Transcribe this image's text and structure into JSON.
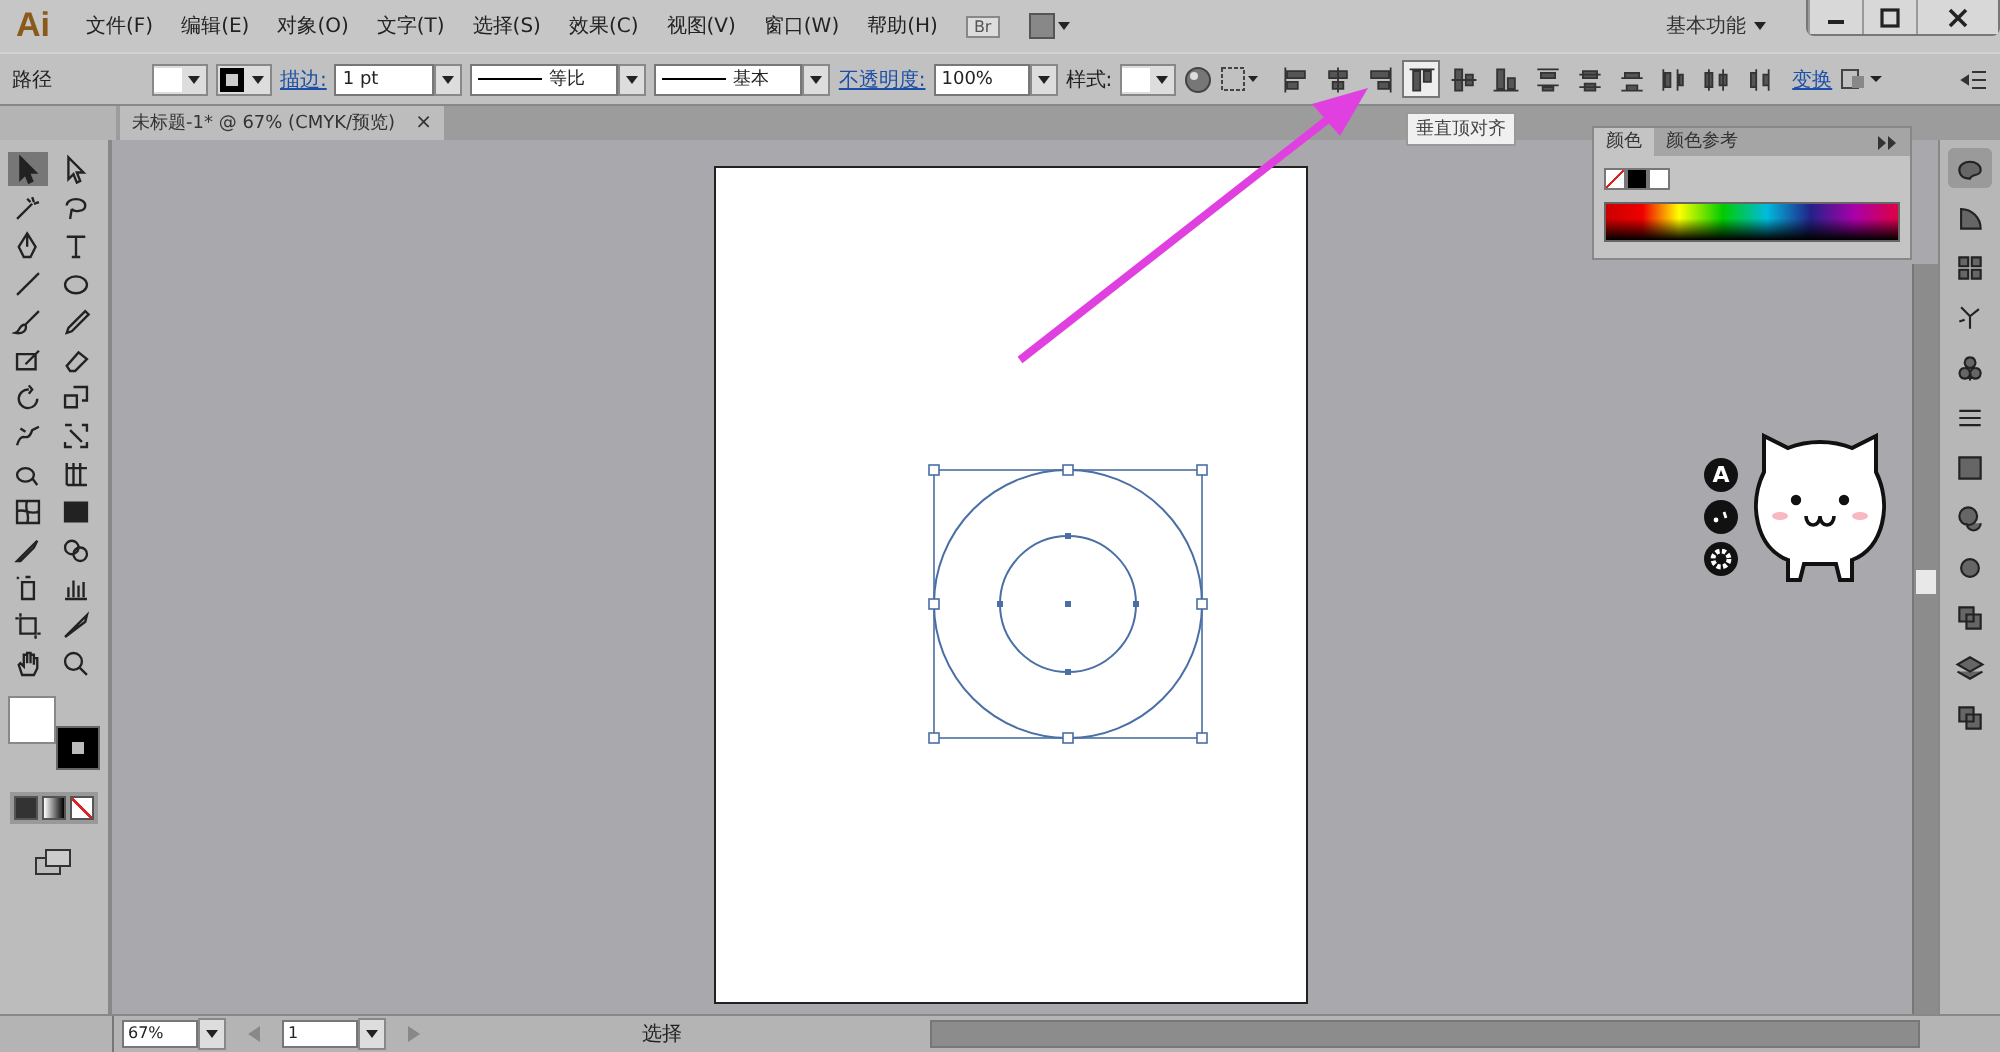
{
  "menu_bar": {
    "logo": "Ai",
    "items": [
      "文件(F)",
      "编辑(E)",
      "对象(O)",
      "文字(T)",
      "选择(S)",
      "效果(C)",
      "视图(V)",
      "窗口(W)",
      "帮助(H)"
    ],
    "bridge": "Br",
    "workspace": "基本功能"
  },
  "control_bar": {
    "selection_label": "路径",
    "stroke_label": "描边:",
    "stroke_weight": "1 pt",
    "profile_1": "等比",
    "profile_2": "基本",
    "opacity_label": "不透明度:",
    "opacity": "100%",
    "style_label": "样式:",
    "transform_label": "变换",
    "align_buttons": [
      {
        "selected": false
      },
      {
        "selected": false
      },
      {
        "selected": false
      },
      {
        "selected": true
      },
      {
        "selected": false
      },
      {
        "selected": false
      },
      {
        "selected": false
      },
      {
        "selected": false
      },
      {
        "selected": false
      },
      {
        "selected": false
      },
      {
        "selected": false
      },
      {
        "selected": false
      }
    ]
  },
  "tooltip": "垂直顶对齐",
  "document_tab": {
    "title": "未标题-1* @ 67% (CMYK/预览)",
    "close": "×"
  },
  "tools": [
    {
      "kind": "select",
      "selected": true
    },
    {
      "kind": "direct",
      "selected": false
    },
    {
      "kind": "wand",
      "selected": false
    },
    {
      "kind": "lasso",
      "selected": false
    },
    {
      "kind": "pen",
      "selected": false
    },
    {
      "kind": "type",
      "selected": false
    },
    {
      "kind": "line",
      "selected": false
    },
    {
      "kind": "ellipse",
      "selected": false
    },
    {
      "kind": "brush",
      "selected": false
    },
    {
      "kind": "pencil",
      "selected": false
    },
    {
      "kind": "blob",
      "selected": false
    },
    {
      "kind": "eraser",
      "selected": false
    },
    {
      "kind": "rotate",
      "selected": false
    },
    {
      "kind": "scale",
      "selected": false
    },
    {
      "kind": "warp",
      "selected": false
    },
    {
      "kind": "free",
      "selected": false
    },
    {
      "kind": "shape",
      "selected": false
    },
    {
      "kind": "grid",
      "selected": false
    },
    {
      "kind": "mesh",
      "selected": false
    },
    {
      "kind": "gradient",
      "selected": false
    },
    {
      "kind": "dropper",
      "selected": false
    },
    {
      "kind": "blend",
      "selected": false
    },
    {
      "kind": "spray",
      "selected": false
    },
    {
      "kind": "chart",
      "selected": false
    },
    {
      "kind": "artboard",
      "selected": false
    },
    {
      "kind": "slice",
      "selected": false
    },
    {
      "kind": "hand",
      "selected": false
    },
    {
      "kind": "zoom",
      "selected": false
    }
  ],
  "color_panel": {
    "tabs": [
      {
        "label": "颜色",
        "selected": true
      },
      {
        "label": "颜色参考",
        "selected": false
      }
    ]
  },
  "overlay": {
    "badge": "A"
  },
  "status_bar": {
    "zoom": "67%",
    "artboard": "1",
    "tool": "选择"
  }
}
